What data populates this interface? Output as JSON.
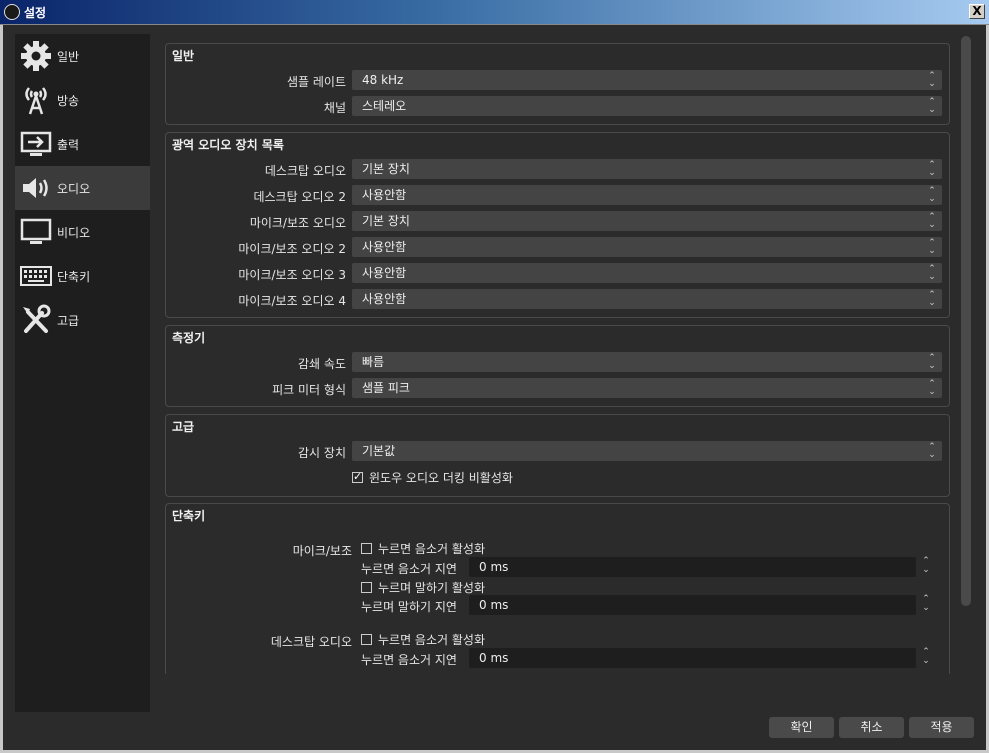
{
  "window": {
    "title": "설정",
    "close_glyph": "X"
  },
  "sidebar": {
    "items": [
      {
        "label": "일반",
        "icon": "gear-icon"
      },
      {
        "label": "방송",
        "icon": "broadcast-tower-icon"
      },
      {
        "label": "출력",
        "icon": "output-monitor-icon"
      },
      {
        "label": "오디오",
        "icon": "speaker-icon",
        "active": true
      },
      {
        "label": "비디오",
        "icon": "monitor-icon"
      },
      {
        "label": "단축키",
        "icon": "keyboard-icon"
      },
      {
        "label": "고급",
        "icon": "tools-icon"
      }
    ]
  },
  "general": {
    "title": "일반",
    "sample_rate": {
      "label": "샘플 레이트",
      "value": "48 kHz"
    },
    "channels": {
      "label": "채널",
      "value": "스테레오"
    }
  },
  "global_devices": {
    "title": "광역 오디오 장치 목록",
    "rows": [
      {
        "label": "데스크탑 오디오",
        "value": "기본 장치"
      },
      {
        "label": "데스크탑 오디오 2",
        "value": "사용안함"
      },
      {
        "label": "마이크/보조 오디오",
        "value": "기본 장치"
      },
      {
        "label": "마이크/보조 오디오 2",
        "value": "사용안함"
      },
      {
        "label": "마이크/보조 오디오 3",
        "value": "사용안함"
      },
      {
        "label": "마이크/보조 오디오 4",
        "value": "사용안함"
      }
    ]
  },
  "meters": {
    "title": "측정기",
    "decay": {
      "label": "감쇄 속도",
      "value": "빠름"
    },
    "peak": {
      "label": "피크 미터 형식",
      "value": "샘플 피크"
    }
  },
  "advanced": {
    "title": "고급",
    "monitor": {
      "label": "감시 장치",
      "value": "기본값"
    },
    "ducking": {
      "label": "윈도우 오디오 더킹 비활성화",
      "checked": true
    }
  },
  "hotkeys": {
    "title": "단축키",
    "mic": {
      "label": "마이크/보조",
      "ptm_enable": "누르면 음소거 활성화",
      "ptm_delay_label": "누르면 음소거 지연",
      "ptm_delay_value": "0 ms",
      "ptt_enable": "누르며 말하기 활성화",
      "ptt_delay_label": "누르며 말하기 지연",
      "ptt_delay_value": "0 ms"
    },
    "desktop": {
      "label": "데스크탑 오디오",
      "ptm_enable": "누르면 음소거 활성화",
      "ptm_delay_label": "누르면 음소거 지연",
      "ptm_delay_value": "0 ms"
    }
  },
  "buttons": {
    "ok": "확인",
    "cancel": "취소",
    "apply": "적용"
  }
}
